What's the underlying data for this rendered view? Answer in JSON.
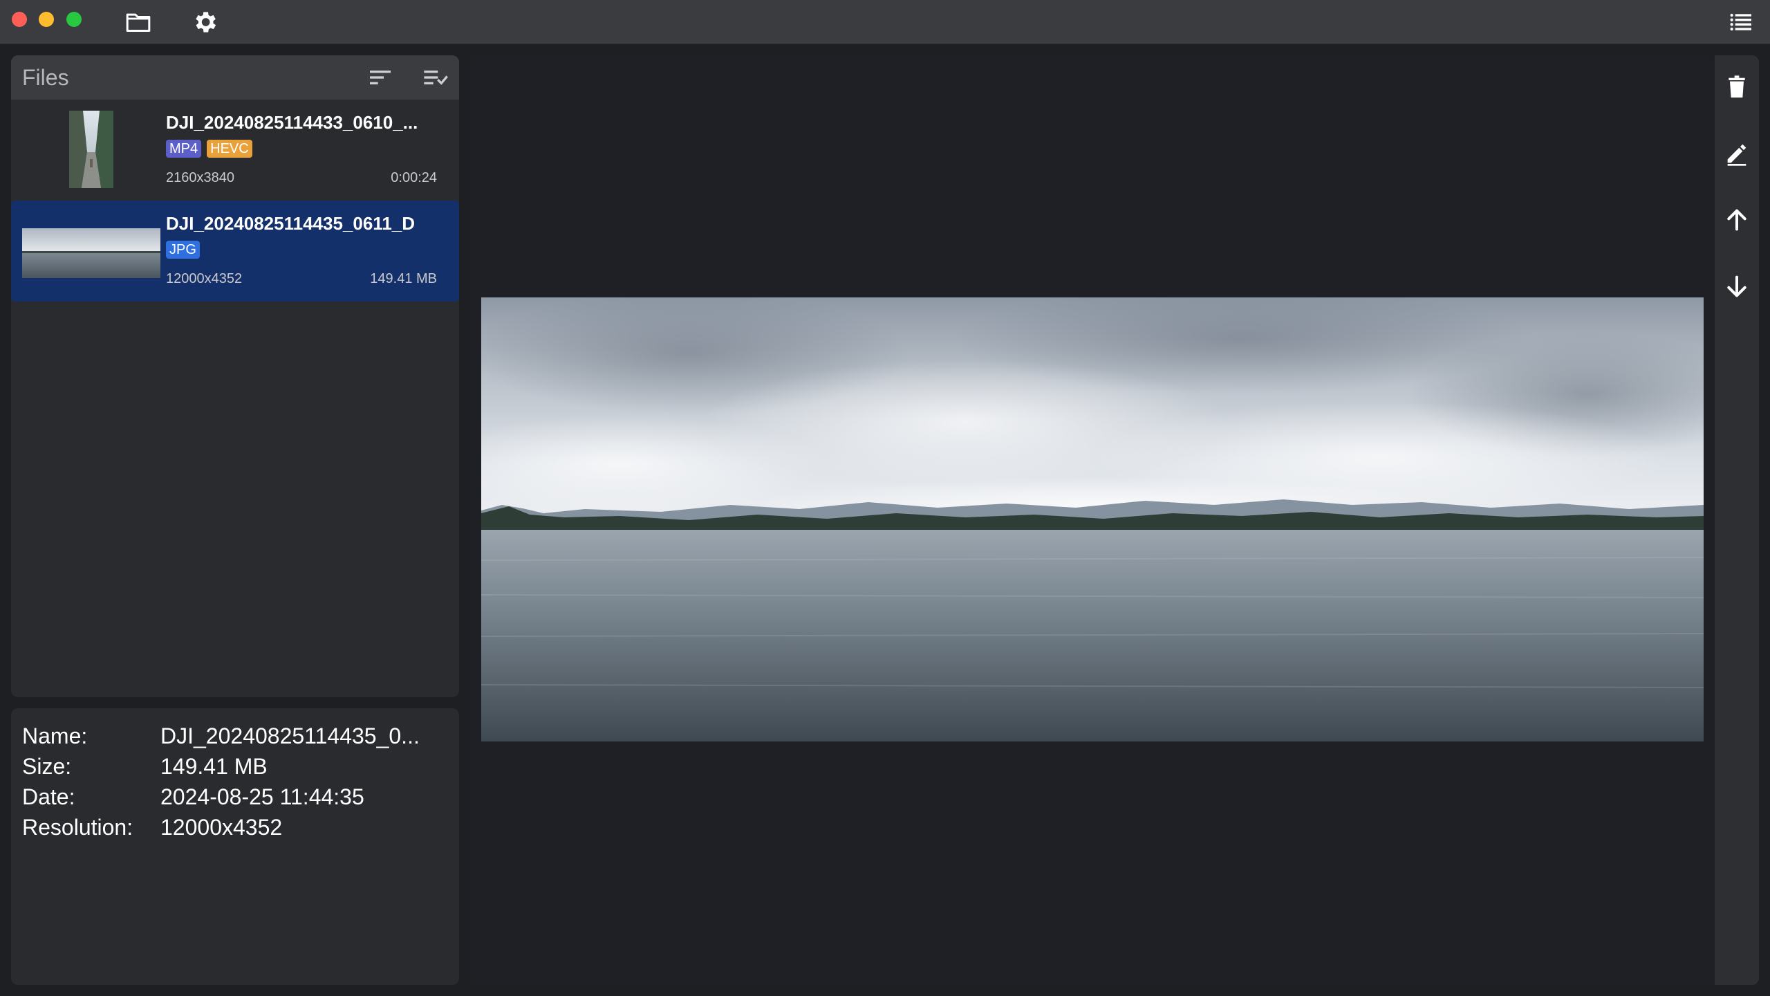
{
  "titlebar": {
    "icons": [
      "folder-icon",
      "gear-icon",
      "list-icon"
    ]
  },
  "files": {
    "title": "Files",
    "items": [
      {
        "name": "DJI_20240825114433_0610_...",
        "badges": [
          {
            "label": "MP4",
            "color": "#5b5fc7"
          },
          {
            "label": "HEVC",
            "color": "#e9a23b"
          }
        ],
        "resolution": "2160x3840",
        "extra": "0:00:24",
        "selected": false
      },
      {
        "name": "DJI_20240825114435_0611_D",
        "badges": [
          {
            "label": "JPG",
            "color": "#2f6fe0"
          }
        ],
        "resolution": "12000x4352",
        "extra": "149.41 MB",
        "selected": true
      }
    ]
  },
  "info": {
    "rows": [
      {
        "label": "Name:",
        "value": "DJI_20240825114435_0..."
      },
      {
        "label": "Size:",
        "value": "149.41 MB"
      },
      {
        "label": "Date:",
        "value": "2024-08-25 11:44:35"
      },
      {
        "label": "Resolution:",
        "value": "12000x4352"
      }
    ]
  },
  "colors": {
    "selected_bg": "#14306b",
    "panel_bg": "#2a2b2f",
    "titlebar_bg": "#3a3c40"
  },
  "right_toolbar": {
    "icons": [
      "trash-icon",
      "pencil-icon",
      "arrow-up-icon",
      "arrow-down-icon"
    ]
  }
}
